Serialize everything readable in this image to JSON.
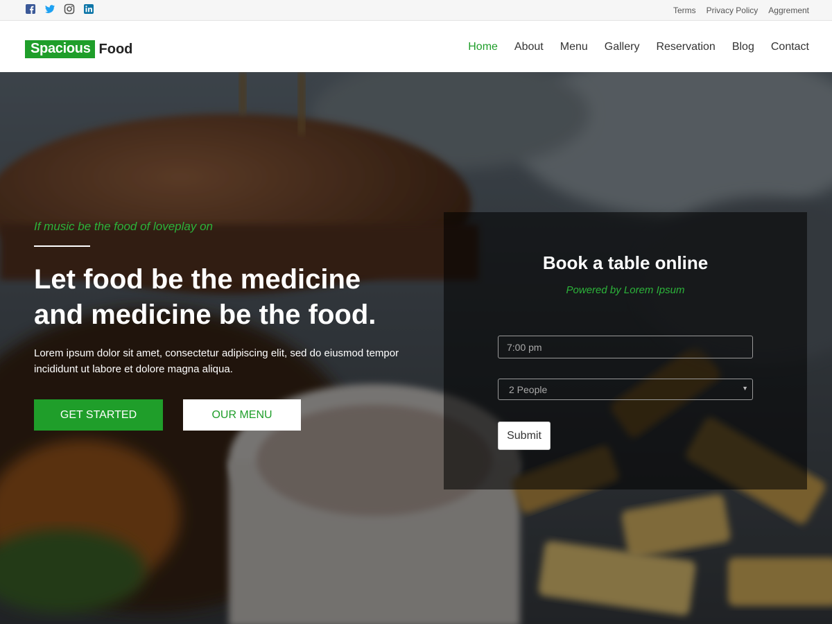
{
  "topbar": {
    "social": [
      {
        "icon": "facebook-icon",
        "color": "#3b5998"
      },
      {
        "icon": "twitter-icon",
        "color": "#1da1f2"
      },
      {
        "icon": "instagram-icon",
        "color": "#555555"
      },
      {
        "icon": "linkedin-icon",
        "color": "#0e76a8"
      }
    ],
    "links": [
      "Terms",
      "Privacy Policy",
      "Aggrement"
    ]
  },
  "header": {
    "logo_highlight": "Spacious",
    "logo_text": "Food",
    "nav": [
      "Home",
      "About",
      "Menu",
      "Gallery",
      "Reservation",
      "Blog",
      "Contact"
    ],
    "active_nav": "Home"
  },
  "hero": {
    "tagline": "If music be the food of loveplay on",
    "headline_line1": "Let food be the medicine",
    "headline_line2": "and medicine be the food.",
    "intro": "Lorem ipsum dolor sit amet, consectetur adipiscing elit, sed do eiusmod tempor incididunt ut labore et dolore magna aliqua.",
    "primary_button": "GET STARTED",
    "secondary_button": "OUR MENU"
  },
  "booking": {
    "title": "Book a table online",
    "subtitle": "Powered by Lorem Ipsum",
    "time_placeholder": "7:00 pm",
    "people_selected": "2 People",
    "submit_label": "Submit"
  },
  "colors": {
    "accent": "#1f9e2a",
    "accent_text": "#2cb33a"
  }
}
